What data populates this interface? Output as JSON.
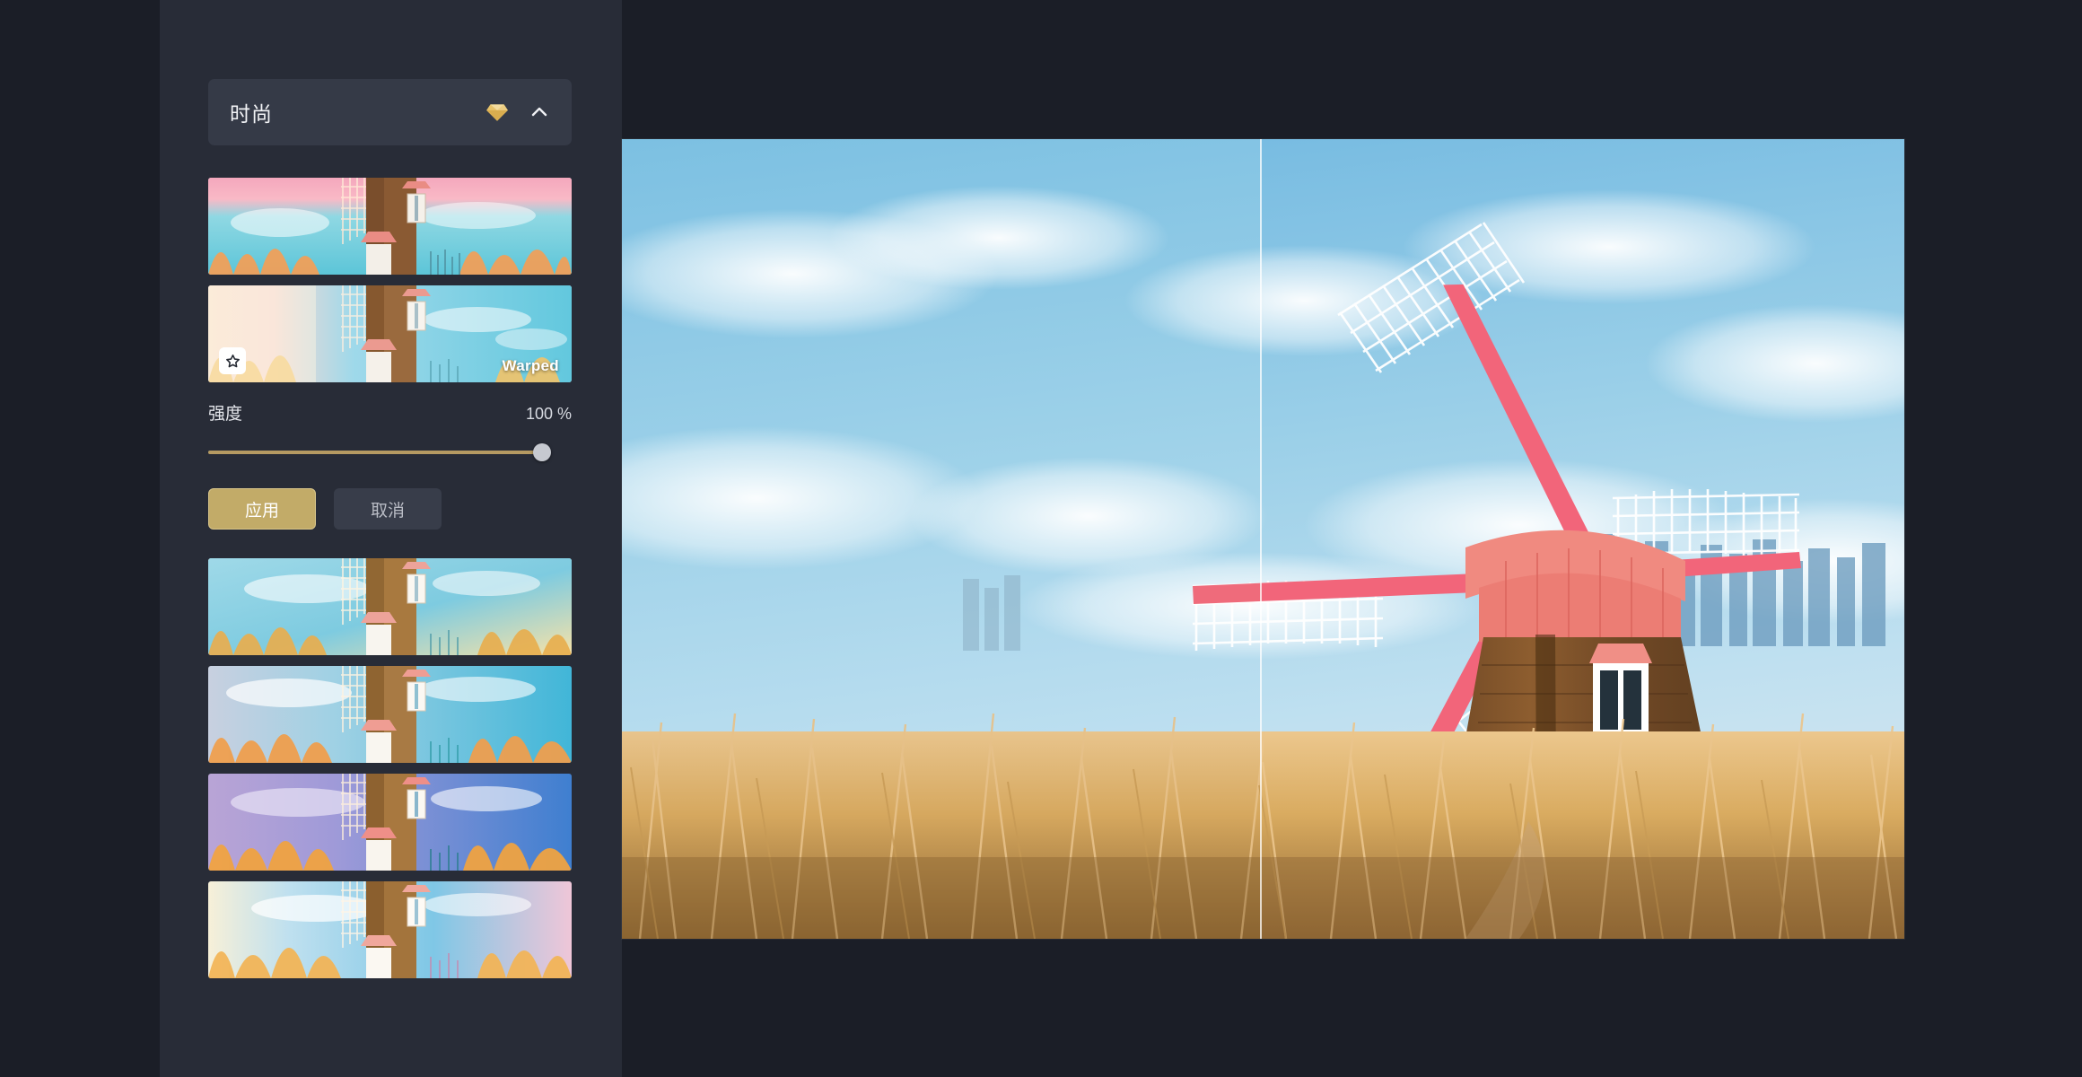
{
  "app": {
    "background_color": "#1b1e27",
    "sidebar_color": "#282c37"
  },
  "sidebar": {
    "header": {
      "title": "时尚",
      "gem_icon": "gem-icon",
      "gem_color": "#e3b84f",
      "collapse_icon": "chevron-up-icon"
    },
    "presets": [
      {
        "label": "",
        "name": "preset-1",
        "selected": false,
        "highlighted": true,
        "favorite": false
      },
      {
        "label": "Warped",
        "name": "preset-warped",
        "selected": true,
        "highlighted": false,
        "favorite": true
      },
      {
        "label": "",
        "name": "preset-3",
        "selected": false,
        "highlighted": true,
        "favorite": false
      },
      {
        "label": "",
        "name": "preset-4",
        "selected": false,
        "highlighted": false,
        "favorite": false
      },
      {
        "label": "",
        "name": "preset-5",
        "selected": false,
        "highlighted": false,
        "favorite": false
      },
      {
        "label": "",
        "name": "preset-6",
        "selected": false,
        "highlighted": false,
        "favorite": false
      }
    ],
    "intensity": {
      "label": "强度",
      "value_text": "100 %",
      "value": 100,
      "min": 0,
      "max": 100,
      "track_color": "#b59a62",
      "thumb_color": "#c6c9d0"
    },
    "actions": {
      "apply_label": "应用",
      "cancel_label": "取消",
      "apply_color": "#c2ab68",
      "cancel_color": "#383d4a"
    }
  },
  "canvas": {
    "subject": "windmill-photo",
    "split_preview": true,
    "left_half_name": "original-image",
    "right_half_name": "preview-image"
  }
}
